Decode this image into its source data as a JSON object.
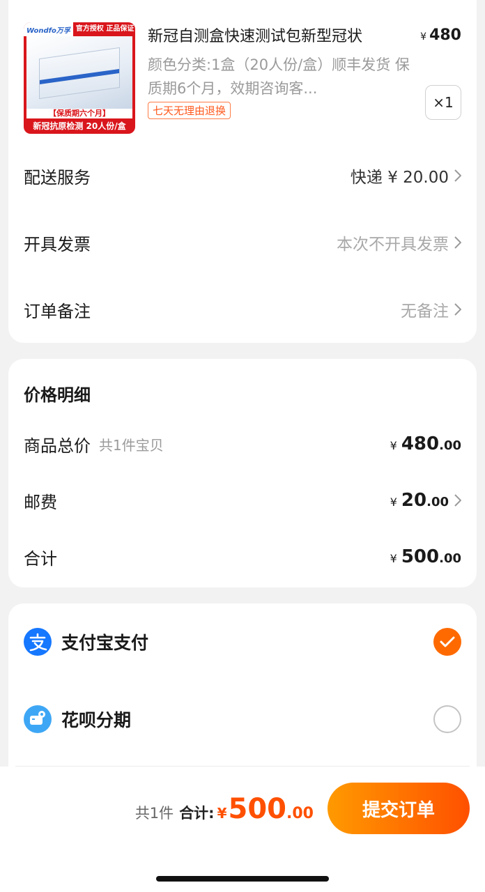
{
  "product": {
    "image_brand": "Wondfo万孚",
    "image_badge": "官方授权 正品保证",
    "image_shelf": "【保质期六个月】",
    "image_caption": "新冠抗原检测 20人份/盒",
    "title": "新冠自测盒快速测试包新型冠状",
    "price_symbol": "¥",
    "price": "480",
    "spec": "颜色分类:1盒（20人份/盒）顺丰发货 保质期6个月，效期咨询客...",
    "return_tag": "七天无理由退换",
    "quantity": "×1"
  },
  "order_rows": [
    {
      "label": "配送服务",
      "value": "快递 ¥ 20.00"
    },
    {
      "label": "开具发票",
      "value": "本次不开具发票"
    },
    {
      "label": "订单备注",
      "value": "无备注"
    }
  ],
  "price_detail": {
    "title": "价格明细",
    "goods_label": "商品总价",
    "goods_sub": "共1件宝贝",
    "goods_yen": "¥",
    "goods_int": "480",
    "goods_dec": ".00",
    "shipping_label": "邮费",
    "shipping_yen": "¥",
    "shipping_int": "20",
    "shipping_dec": ".00",
    "total_label": "合计",
    "total_yen": "¥",
    "total_int": "500",
    "total_dec": ".00"
  },
  "payment": {
    "options": [
      {
        "label": "支付宝支付",
        "icon": "alipay-icon",
        "selected": true
      },
      {
        "label": "花呗分期",
        "icon": "huabei-icon",
        "selected": false
      }
    ]
  },
  "bottom_bar": {
    "count": "共1件",
    "total_label": "合计:",
    "yen": "¥",
    "total_int": "500",
    "total_dec": ".00",
    "submit_label": "提交订单"
  },
  "colors": {
    "accent": "#ff5000",
    "alipay": "#1677ff",
    "huabei": "#3ea7f5",
    "selected": "#ff6a00"
  }
}
